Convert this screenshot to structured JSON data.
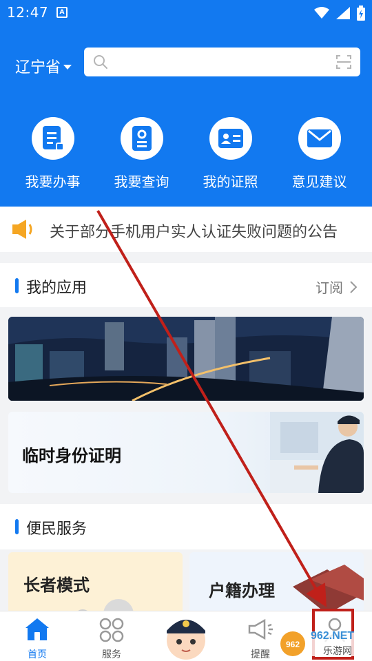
{
  "status": {
    "time": "12:47",
    "app_icon": "A"
  },
  "header": {
    "province": "辽宁省",
    "search_placeholder": "",
    "quick_actions": [
      {
        "label": "我要办事",
        "icon": "document-icon"
      },
      {
        "label": "我要查询",
        "icon": "query-icon"
      },
      {
        "label": "我的证照",
        "icon": "id-card-icon"
      },
      {
        "label": "意见建议",
        "icon": "mail-icon"
      }
    ]
  },
  "notice": {
    "text": "关于部分手机用户实人认证失败问题的公告"
  },
  "my_apps": {
    "title": "我的应用",
    "more": "订阅",
    "temp_id_title": "临时身份证明"
  },
  "services": {
    "title": "便民服务",
    "cards": [
      "长者模式",
      "户籍办理"
    ]
  },
  "nav": {
    "items": [
      "首页",
      "服务",
      "",
      "提醒",
      ""
    ]
  },
  "watermark": {
    "text_top": "962.NET",
    "text_bottom": "乐游网"
  },
  "colors": {
    "primary": "#1279f0",
    "annotation": "#c0201a"
  }
}
